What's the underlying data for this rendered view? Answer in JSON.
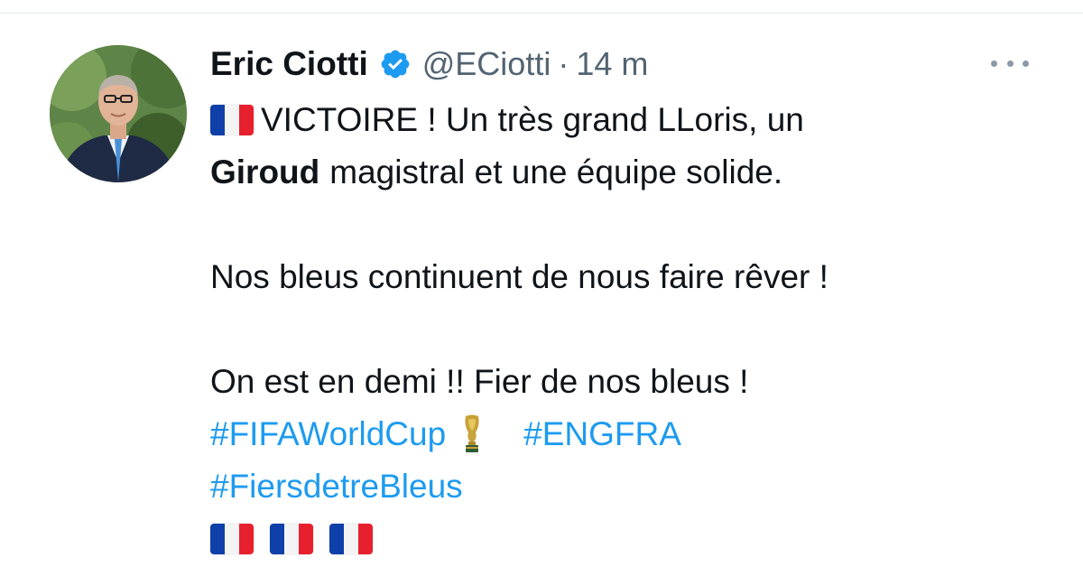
{
  "tweet": {
    "author": {
      "display_name": "Eric Ciotti",
      "handle": "@ECiotti",
      "verified": true
    },
    "separator": "·",
    "time": "14 m",
    "text": {
      "line1_part1": "VICTOIRE ! Un très grand LLoris, un",
      "line2_bold": "Giroud",
      "line2_rest": "magistral et une équipe solide.",
      "line3": "Nos bleus continuent de nous faire rêver !",
      "line4": "On est en demi !! Fier de nos bleus !"
    },
    "hashtags": [
      "#FIFAWorldCup",
      "#ENGFRA",
      "#FiersdetreBleus"
    ],
    "emoji": {
      "flag": "france-flag",
      "trophy": "trophy-icon",
      "trailing_flags_count": 3
    },
    "icons": [
      "verified-badge-icon",
      "more-options-icon"
    ],
    "colors": {
      "link": "#1d9bf0",
      "verified": "#1d9bf0",
      "secondary_text": "#536471",
      "primary_text": "#0f1419"
    }
  }
}
